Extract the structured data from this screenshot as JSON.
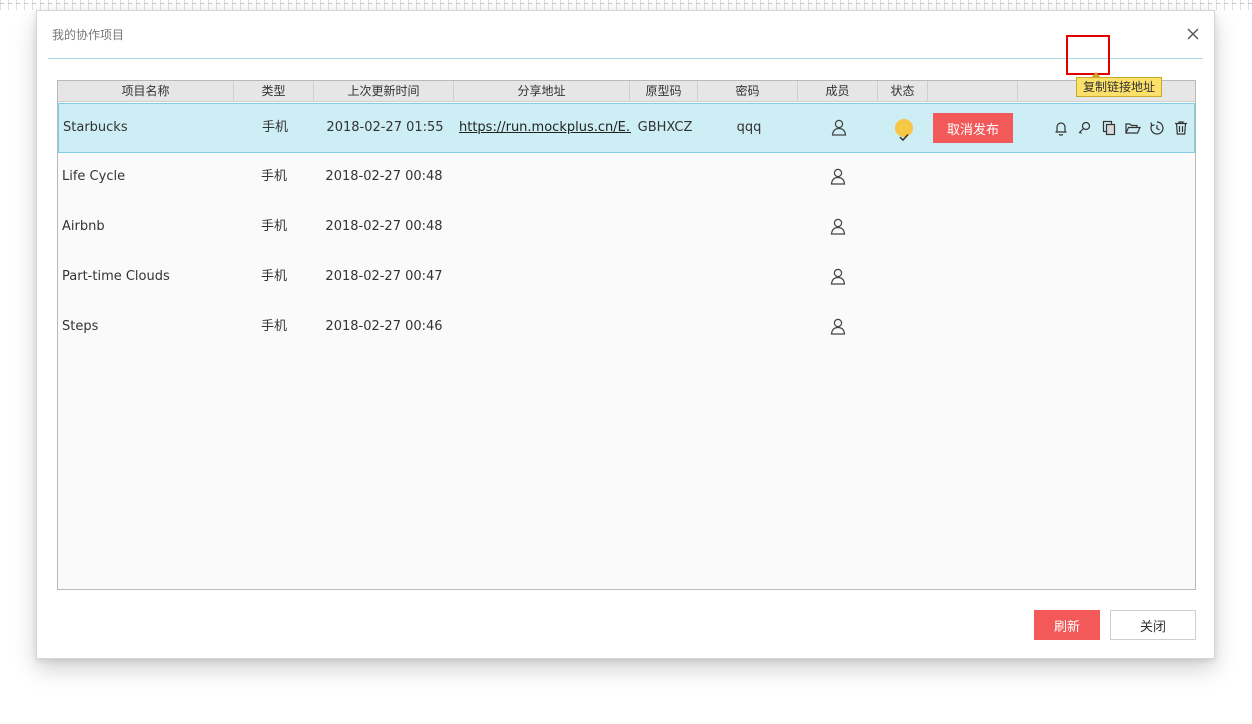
{
  "dialog": {
    "title": "我的协作项目",
    "refresh_label": "刷新",
    "close_label": "关闭"
  },
  "table": {
    "columns": [
      "项目名称",
      "类型",
      "上次更新时间",
      "分享地址",
      "原型码",
      "密码",
      "成员",
      "状态",
      ""
    ],
    "rows": [
      {
        "name": "Starbucks",
        "type": "手机",
        "updated": "2018-02-27 01:55",
        "url": "https://run.mockplus.cn/E...",
        "code": "GBHXCZ",
        "password": "qqq",
        "published": true,
        "action": "取消发布"
      },
      {
        "name": "Life Cycle",
        "type": "手机",
        "updated": "2018-02-27 00:48",
        "url": "",
        "code": "",
        "password": "",
        "published": false
      },
      {
        "name": "Airbnb",
        "type": "手机",
        "updated": "2018-02-27 00:48",
        "url": "",
        "code": "",
        "password": "",
        "published": false
      },
      {
        "name": "Part-time Clouds",
        "type": "手机",
        "updated": "2018-02-27 00:47",
        "url": "",
        "code": "",
        "password": "",
        "published": false
      },
      {
        "name": "Steps",
        "type": "手机",
        "updated": "2018-02-27 00:46",
        "url": "",
        "code": "",
        "password": "",
        "published": false
      }
    ]
  },
  "row_actions": {
    "icons": [
      "bell-icon",
      "key-icon",
      "copy-icon",
      "folder-open-icon",
      "history-icon",
      "trash-icon"
    ],
    "tooltip": "复制链接地址"
  },
  "colors": {
    "accent_red": "#f4595a",
    "selection_bg": "#cdeef4",
    "status_check": "#f6c744",
    "highlight_box": "#e00000",
    "tooltip_bg": "#fbe06a"
  }
}
